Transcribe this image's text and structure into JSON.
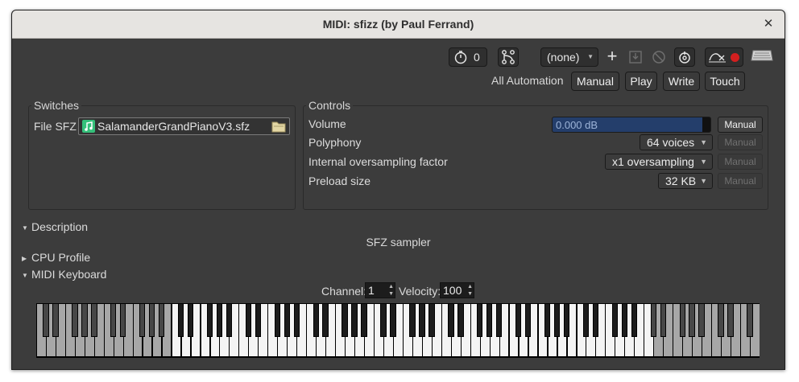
{
  "window": {
    "title": "MIDI: sfizz (by Paul Ferrand)"
  },
  "toolbar": {
    "latency_value": "0",
    "preset": "(none)",
    "automation_label": "All Automation",
    "automation_modes": [
      "Manual",
      "Play",
      "Write",
      "Touch"
    ]
  },
  "switches": {
    "legend": "Switches",
    "file_label": "File SFZ",
    "file_value": "SalamanderGrandPianoV3.sfz"
  },
  "controls": {
    "legend": "Controls",
    "rows": [
      {
        "label": "Volume",
        "value": "0.000 dB",
        "level": 0.95,
        "mode": "Manual",
        "mode_enabled": true
      },
      {
        "label": "Polyphony",
        "value": "64 voices",
        "mode": "Manual",
        "mode_enabled": false
      },
      {
        "label": "Internal oversampling factor",
        "value": "x1 oversampling",
        "mode": "Manual",
        "mode_enabled": false
      },
      {
        "label": "Preload size",
        "value": "32 KB",
        "mode": "Manual",
        "mode_enabled": false
      }
    ]
  },
  "sections": {
    "description": {
      "label": "Description",
      "expanded": true,
      "text": "SFZ sampler"
    },
    "cpu_profile": {
      "label": "CPU Profile",
      "expanded": false
    },
    "midi_keyboard": {
      "label": "MIDI Keyboard",
      "expanded": true
    }
  },
  "midi": {
    "channel_label": "Channel:",
    "channel": "1",
    "velocity_label": "Velocity:",
    "velocity": "100"
  },
  "keyboard": {
    "white_keys": 75,
    "dimmed_low_white_keys": 14,
    "dimmed_high_white_keys": 11,
    "colors": {
      "white": "#f4f4f4",
      "dimmed_white": "#a7a7a7",
      "black": "#1c1c1c",
      "dimmed_black": "#474747"
    }
  },
  "colors": {
    "window_bg": "#3c3c3c",
    "titlebar_bg": "#e6e4e1",
    "record": "#d21f1f",
    "file_icon": "#35c07a"
  }
}
